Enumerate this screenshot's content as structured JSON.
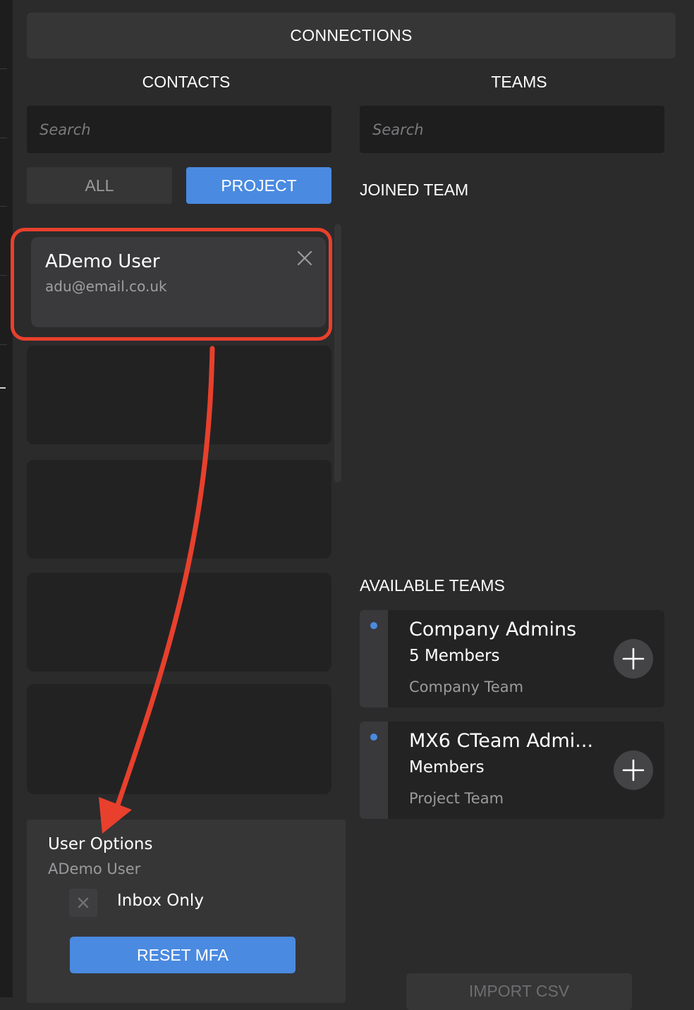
{
  "header": {
    "title": "CONNECTIONS"
  },
  "contacts": {
    "title": "CONTACTS",
    "search_placeholder": "Search",
    "filter_all_label": "ALL",
    "filter_project_label": "PROJECT",
    "selected_filter": "PROJECT",
    "items": [
      {
        "name": "ADemo User",
        "email": "adu@email.co.uk"
      }
    ]
  },
  "teams": {
    "title": "TEAMS",
    "search_placeholder": "Search",
    "joined_label": "JOINED TEAM",
    "available_label": "AVAILABLE TEAMS",
    "available": [
      {
        "name": "Company Admins",
        "members": "5 Members",
        "type": "Company Team"
      },
      {
        "name": "MX6 CTeam Admi...",
        "members": "Members",
        "type": "Project Team"
      }
    ]
  },
  "user_options": {
    "title": "User Options",
    "user_name": "ADemo User",
    "inbox_only_label": "Inbox Only",
    "inbox_only_checked": false,
    "reset_mfa_label": "RESET MFA"
  },
  "import_csv_label": "IMPORT CSV",
  "colors": {
    "background": "#2b2b2c",
    "accent": "#4a8ae0",
    "annotation": "#e8402c"
  }
}
